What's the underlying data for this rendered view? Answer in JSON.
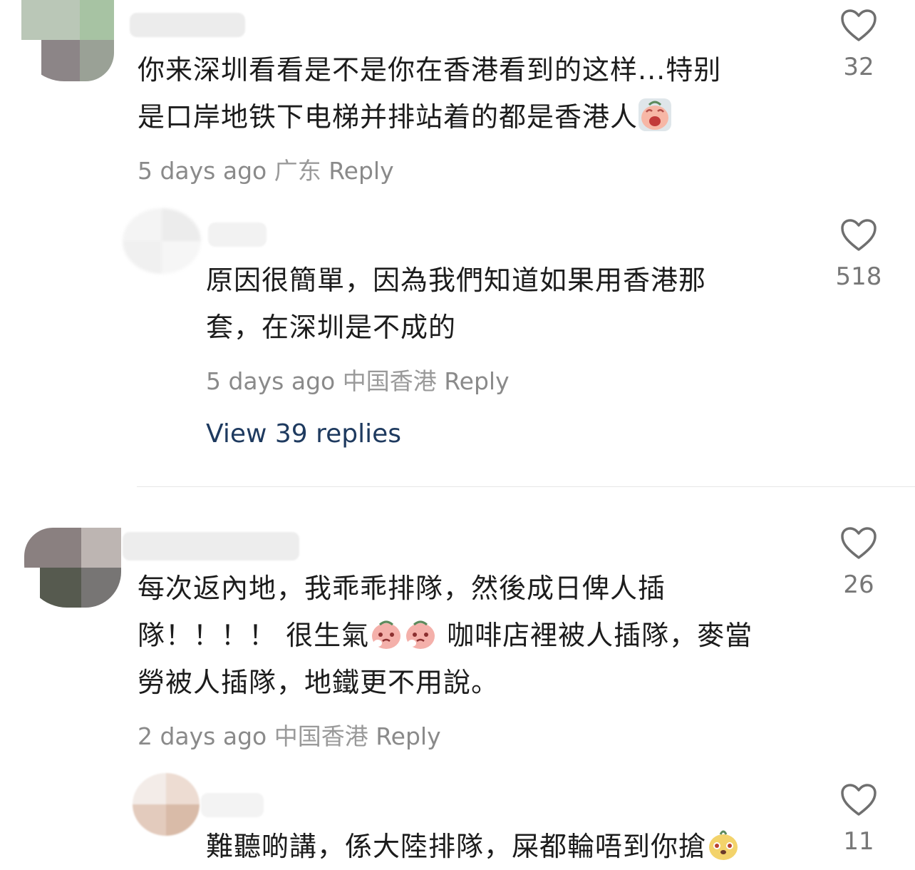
{
  "comments": [
    {
      "text_lines": [
        "你来深圳看看是不是你在香港看到的这样...特别",
        "是口岸地铁下电梯并排站着的都是香港人"
      ],
      "time": "5 days ago",
      "location": "广东",
      "reply_label": "Reply",
      "likes": "32"
    },
    {
      "text_lines": [
        "原因很簡單，因為我們知道如果用香港那",
        "套，在深圳是不成的"
      ],
      "time": "5 days ago",
      "location": "中国香港",
      "reply_label": "Reply",
      "likes": "518",
      "view_replies": "View 39 replies"
    },
    {
      "text_lines": [
        "每次返內地，我乖乖排隊，然後成日俾人插",
        "隊！！！！  很生氣",
        " 咖啡店裡被人插隊，麥當",
        "勞被人插隊，地鐵更不用說。"
      ],
      "time": "2 days ago",
      "location": "中国香港",
      "reply_label": "Reply",
      "likes": "26"
    },
    {
      "text_lines": [
        "難聽啲講，係大陸排隊，屎都輪唔到你搶"
      ],
      "likes": "11"
    }
  ],
  "icons": {
    "like": "heart-outline-icon",
    "emoji_1": "crying-face-emoji",
    "emoji_2": "sweating-face-emoji",
    "emoji_3": "smug-face-emoji"
  },
  "colors": {
    "link": "#1e3a5f",
    "meta": "#8a8a8a"
  }
}
